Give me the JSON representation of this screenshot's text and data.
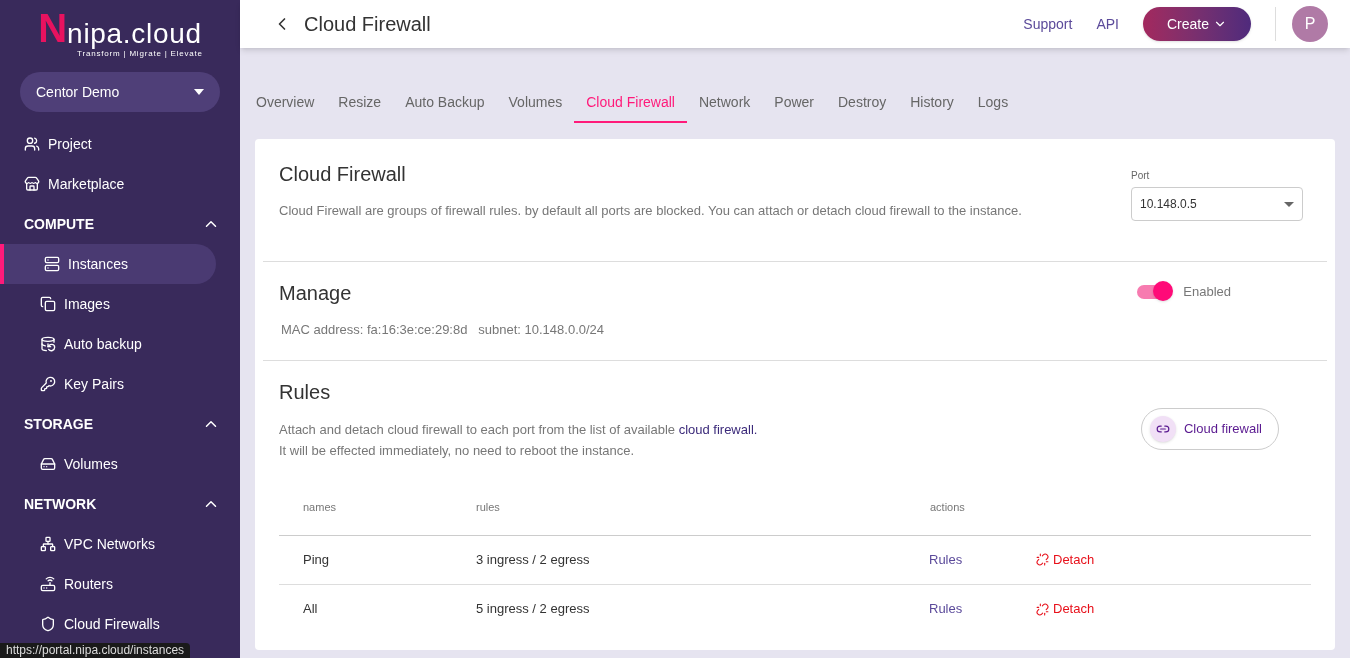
{
  "logo": {
    "mark": "N",
    "name": "nipa.cloud",
    "tagline": "Transform | Migrate | Elevate"
  },
  "project_selector": {
    "value": "Centor Demo"
  },
  "sidebar": {
    "items": [
      {
        "kind": "link",
        "label": "Project",
        "selected": false
      },
      {
        "kind": "link",
        "label": "Marketplace",
        "selected": false
      },
      {
        "kind": "section",
        "label": "COMPUTE",
        "expanded": true,
        "children": [
          {
            "label": "Instances",
            "selected": true
          },
          {
            "label": "Images",
            "selected": false
          },
          {
            "label": "Auto backup",
            "selected": false
          },
          {
            "label": "Key Pairs",
            "selected": false
          }
        ]
      },
      {
        "kind": "section",
        "label": "STORAGE",
        "expanded": true,
        "children": [
          {
            "label": "Volumes",
            "selected": false
          }
        ]
      },
      {
        "kind": "section",
        "label": "NETWORK",
        "expanded": true,
        "children": [
          {
            "label": "VPC Networks",
            "selected": false
          },
          {
            "label": "Routers",
            "selected": false
          },
          {
            "label": "Cloud Firewalls",
            "selected": false
          }
        ]
      }
    ]
  },
  "status_url": "https://portal.nipa.cloud/instances",
  "header": {
    "title": "Cloud Firewall",
    "links": [
      "Support",
      "API"
    ],
    "create_button": "Create",
    "avatar": "P"
  },
  "tabs": [
    {
      "label": "Overview",
      "selected": false
    },
    {
      "label": "Resize",
      "selected": false
    },
    {
      "label": "Auto Backup",
      "selected": false
    },
    {
      "label": "Volumes",
      "selected": false
    },
    {
      "label": "Cloud Firewall",
      "selected": true
    },
    {
      "label": "Network",
      "selected": false
    },
    {
      "label": "Power",
      "selected": false
    },
    {
      "label": "Destroy",
      "selected": false
    },
    {
      "label": "History",
      "selected": false
    },
    {
      "label": "Logs",
      "selected": false
    }
  ],
  "firewall": {
    "title": "Cloud Firewall",
    "description": "Cloud Firewall are groups of firewall rules. by default all ports are blocked. You can attach or detach cloud firewall to the instance.",
    "port": {
      "label": "Port",
      "value": "10.148.0.5"
    }
  },
  "manage": {
    "title": "Manage",
    "details": "MAC address: fa:16:3e:ce:29:8d   subnet: 10.148.0.0/24",
    "toggle": {
      "label": "Enabled",
      "on": true
    }
  },
  "rules": {
    "title": "Rules",
    "description_before": "Attach and detach cloud firewall to each port from the list of available ",
    "description_link": "cloud firewall.",
    "description_after": "It will be effected immediately, no need to reboot the instance.",
    "button": "Cloud firewall",
    "table": {
      "columns": [
        "names",
        "rules",
        "actions"
      ],
      "rows": [
        {
          "name": "Ping",
          "rules": "3 ingress / 2 egress",
          "rules_link": "Rules",
          "detach": "Detach"
        },
        {
          "name": "All",
          "rules": "5 ingress / 2 egress",
          "rules_link": "Rules",
          "detach": "Detach"
        }
      ]
    }
  }
}
